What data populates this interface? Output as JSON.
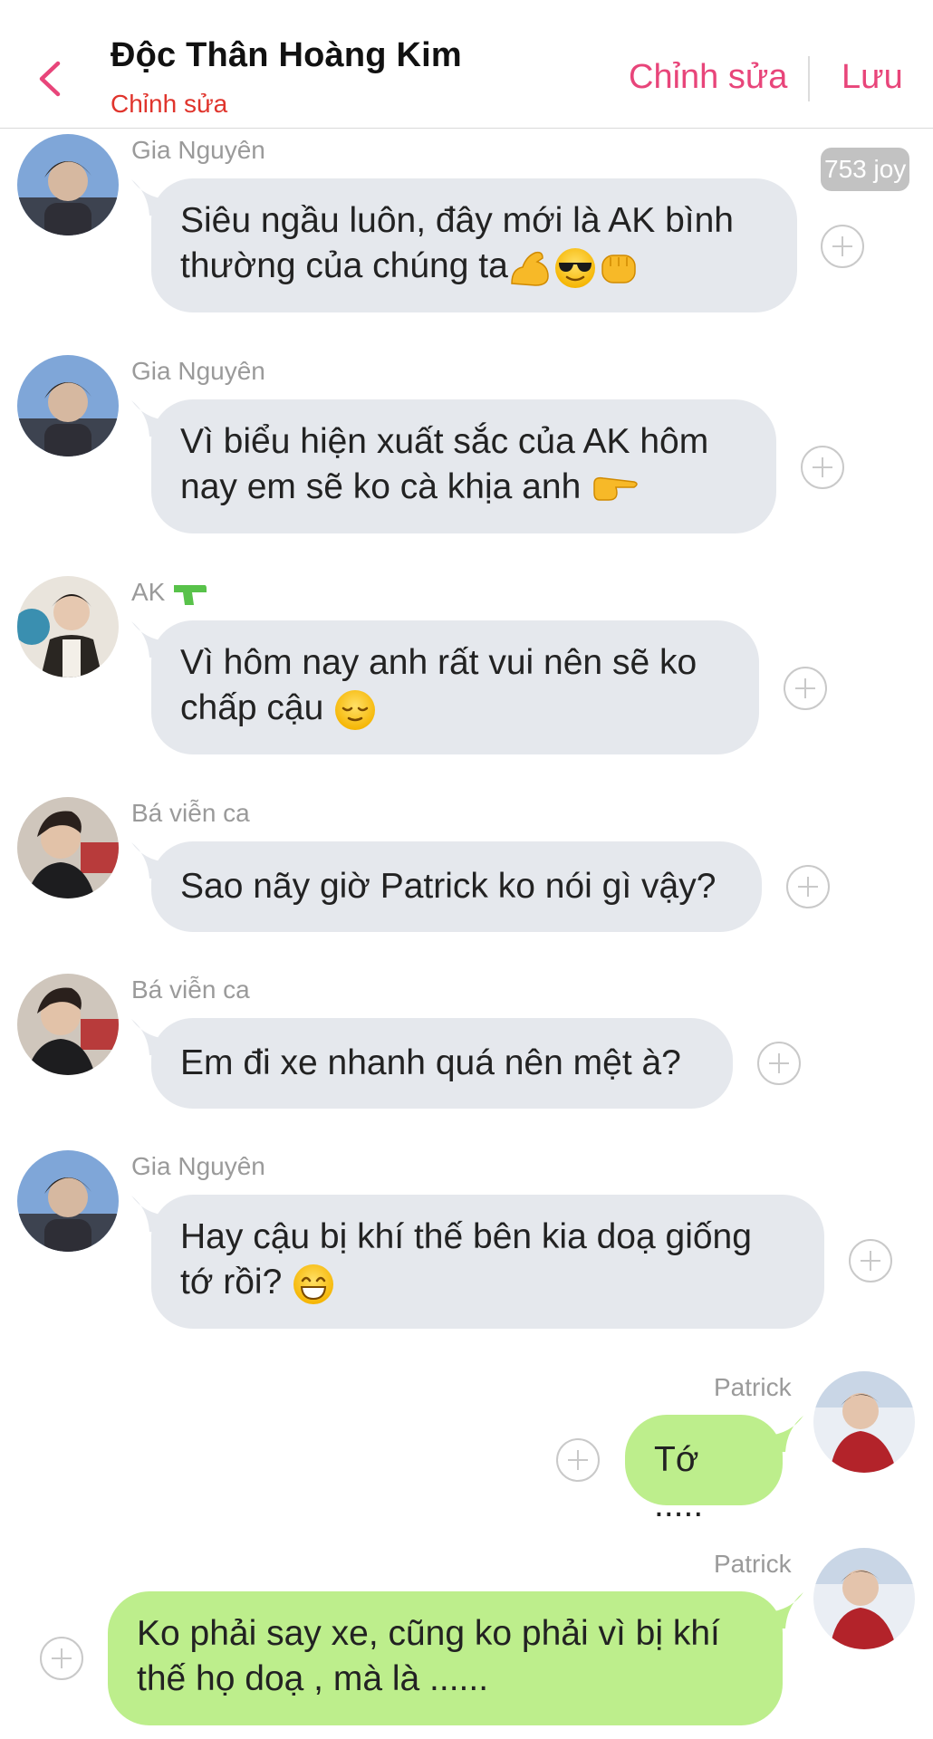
{
  "header": {
    "title": "Độc Thân Hoàng Kim",
    "subtitle": "Chỉnh sửa",
    "edit_label": "Chỉnh sửa",
    "save_label": "Lưu"
  },
  "badge": "753 joy",
  "messages": [
    {
      "sender": "Gia Nguyên",
      "line1": "Siêu ngầu luôn, đây mới là AK bình",
      "line2": "thường của chúng ta",
      "emoji": [
        "flexed-biceps",
        "sunglasses-face",
        "fist"
      ]
    },
    {
      "sender": "Gia Nguyên",
      "line1": "Vì biểu hiện xuất sắc của AK hôm",
      "line2": "nay em sẽ ko cà khịa anh ",
      "emoji": [
        "pointing-right"
      ]
    },
    {
      "sender": "AK",
      "sender_emoji": "water-pistol",
      "line1": "Vì hôm nay anh rất vui nên sẽ ko",
      "line2": "chấp cậu ",
      "emoji": [
        "relieved-face"
      ]
    },
    {
      "sender": "Bá viễn ca",
      "line1": "Sao nãy giờ Patrick ko nói gì vậy?"
    },
    {
      "sender": "Bá viễn ca",
      "line1": "Em đi xe nhanh quá nên mệt à?"
    },
    {
      "sender": "Gia Nguyên",
      "line1": "Hay cậu bị khí thế bên kia doạ giống",
      "line2": "tớ rồi? ",
      "emoji": [
        "grinning-face"
      ]
    },
    {
      "sender": "Patrick",
      "line1": "Tớ ....."
    },
    {
      "sender": "Patrick",
      "line1": "Ko phải say xe, cũng ko phải vì bị khí",
      "line2": "thế họ doạ , mà là ......"
    }
  ],
  "colors": {
    "accent": "#e8457a",
    "subtitle": "#e0342c",
    "incoming_bubble": "#e5e8ed",
    "outgoing_bubble": "#bdee8c"
  }
}
